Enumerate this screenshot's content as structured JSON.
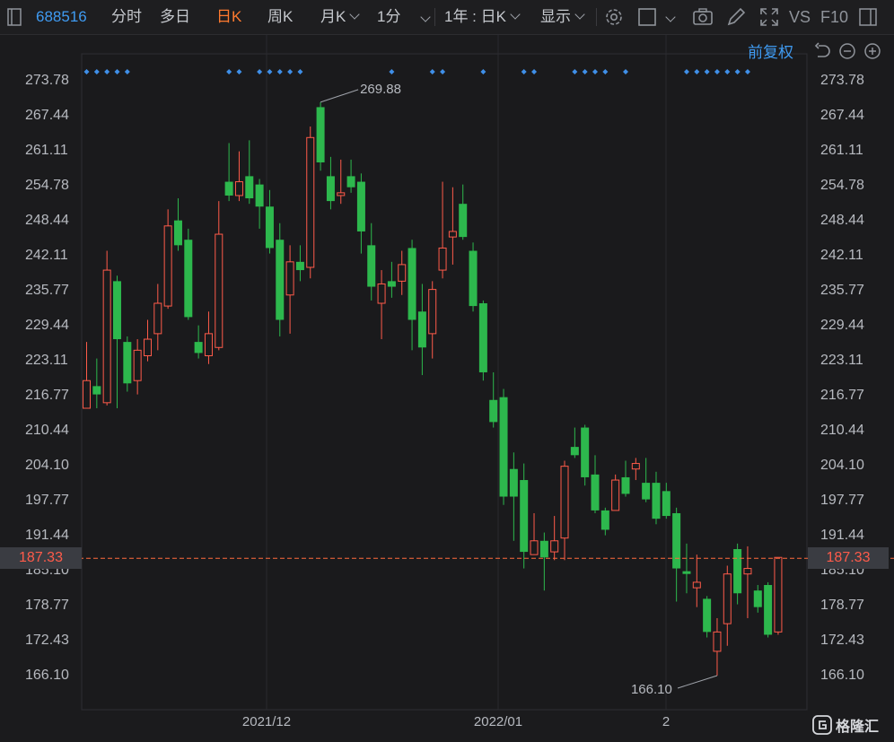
{
  "toolbar": {
    "stock_code": "688516",
    "tabs": [
      "分时",
      "多日",
      "日K",
      "周K",
      "月K",
      "1分"
    ],
    "active_tab": "日K",
    "range_label": "1年 : 日K",
    "display_label": "显示",
    "vs_label": "VS",
    "f10_label": "F10"
  },
  "chart_controls": {
    "adjust_label": "前复权"
  },
  "chart_data": {
    "type": "candlestick",
    "y_ticks": [
      "273.78",
      "267.44",
      "261.11",
      "254.78",
      "248.44",
      "242.11",
      "235.77",
      "229.44",
      "223.11",
      "216.77",
      "210.44",
      "204.10",
      "197.77",
      "191.44",
      "185.10",
      "178.77",
      "172.43",
      "166.10"
    ],
    "ylim": [
      166.1,
      273.78
    ],
    "x_labels": [
      "2021/12",
      "2022/01",
      "2"
    ],
    "last_price": "187.33",
    "high_label": "269.88",
    "low_label": "166.10",
    "up_color": "#ff5b4a",
    "down_color": "#2db84d",
    "candles": [
      {
        "o": 214.5,
        "c": 219.5,
        "h": 226.5,
        "l": 214.5
      },
      {
        "o": 218.5,
        "c": 217.0,
        "h": 223.5,
        "l": 214.5
      },
      {
        "o": 215.5,
        "c": 239.5,
        "h": 243.0,
        "l": 215.0
      },
      {
        "o": 237.5,
        "c": 227.0,
        "h": 238.5,
        "l": 214.5
      },
      {
        "o": 226.5,
        "c": 219.0,
        "h": 227.5,
        "l": 217.5
      },
      {
        "o": 219.5,
        "c": 225.0,
        "h": 227.0,
        "l": 217.0
      },
      {
        "o": 224.0,
        "c": 227.0,
        "h": 230.5,
        "l": 223.0
      },
      {
        "o": 228.0,
        "c": 233.5,
        "h": 237.0,
        "l": 225.0
      },
      {
        "o": 233.0,
        "c": 247.5,
        "h": 250.5,
        "l": 232.5
      },
      {
        "o": 248.5,
        "c": 244.0,
        "h": 252.5,
        "l": 243.0
      },
      {
        "o": 245.0,
        "c": 231.0,
        "h": 247.0,
        "l": 230.5
      },
      {
        "o": 226.5,
        "c": 224.5,
        "h": 229.5,
        "l": 223.5
      },
      {
        "o": 224.0,
        "c": 228.0,
        "h": 232.0,
        "l": 222.5
      },
      {
        "o": 225.5,
        "c": 246.0,
        "h": 252.0,
        "l": 225.0
      },
      {
        "o": 255.5,
        "c": 253.0,
        "h": 262.5,
        "l": 252.0
      },
      {
        "o": 253.0,
        "c": 255.5,
        "h": 261.0,
        "l": 252.0
      },
      {
        "o": 256.5,
        "c": 252.5,
        "h": 263.0,
        "l": 251.5
      },
      {
        "o": 255.0,
        "c": 251.0,
        "h": 256.0,
        "l": 247.0
      },
      {
        "o": 251.0,
        "c": 243.5,
        "h": 254.0,
        "l": 242.5
      },
      {
        "o": 245.0,
        "c": 230.5,
        "h": 248.0,
        "l": 227.5
      },
      {
        "o": 235.0,
        "c": 241.0,
        "h": 244.0,
        "l": 228.0
      },
      {
        "o": 241.0,
        "c": 239.5,
        "h": 244.0,
        "l": 237.5
      },
      {
        "o": 240.0,
        "c": 263.5,
        "h": 265.5,
        "l": 238.0
      },
      {
        "o": 269.0,
        "c": 259.0,
        "h": 269.9,
        "l": 257.5
      },
      {
        "o": 256.5,
        "c": 252.0,
        "h": 260.0,
        "l": 250.5
      },
      {
        "o": 253.0,
        "c": 253.5,
        "h": 259.5,
        "l": 251.5
      },
      {
        "o": 256.5,
        "c": 254.5,
        "h": 259.5,
        "l": 253.5
      },
      {
        "o": 255.5,
        "c": 246.5,
        "h": 257.0,
        "l": 242.5
      },
      {
        "o": 244.0,
        "c": 236.5,
        "h": 248.0,
        "l": 234.0
      },
      {
        "o": 233.5,
        "c": 237.0,
        "h": 239.5,
        "l": 227.0
      },
      {
        "o": 237.5,
        "c": 236.5,
        "h": 241.0,
        "l": 234.5
      },
      {
        "o": 237.5,
        "c": 240.5,
        "h": 243.0,
        "l": 235.0
      },
      {
        "o": 243.5,
        "c": 230.5,
        "h": 245.0,
        "l": 225.0
      },
      {
        "o": 232.0,
        "c": 225.5,
        "h": 237.0,
        "l": 220.5
      },
      {
        "o": 228.0,
        "c": 236.0,
        "h": 237.5,
        "l": 223.5
      },
      {
        "o": 239.5,
        "c": 243.5,
        "h": 255.5,
        "l": 238.0
      },
      {
        "o": 245.5,
        "c": 246.5,
        "h": 254.5,
        "l": 240.5
      },
      {
        "o": 251.5,
        "c": 245.5,
        "h": 255.0,
        "l": 245.0
      },
      {
        "o": 243.0,
        "c": 233.0,
        "h": 244.5,
        "l": 232.0
      },
      {
        "o": 233.5,
        "c": 221.0,
        "h": 234.0,
        "l": 219.5
      },
      {
        "o": 216.0,
        "c": 212.0,
        "h": 221.0,
        "l": 211.0
      },
      {
        "o": 216.5,
        "c": 198.5,
        "h": 218.0,
        "l": 197.0
      },
      {
        "o": 203.5,
        "c": 198.5,
        "h": 206.5,
        "l": 190.5
      },
      {
        "o": 201.5,
        "c": 188.5,
        "h": 204.5,
        "l": 185.5
      },
      {
        "o": 188.0,
        "c": 190.5,
        "h": 195.5,
        "l": 188.0
      },
      {
        "o": 190.5,
        "c": 187.5,
        "h": 192.0,
        "l": 181.5
      },
      {
        "o": 188.5,
        "c": 190.5,
        "h": 195.0,
        "l": 187.0
      },
      {
        "o": 191.0,
        "c": 204.0,
        "h": 205.0,
        "l": 187.0
      },
      {
        "o": 207.5,
        "c": 206.0,
        "h": 211.0,
        "l": 205.5
      },
      {
        "o": 211.0,
        "c": 202.0,
        "h": 211.5,
        "l": 200.5
      },
      {
        "o": 202.5,
        "c": 196.0,
        "h": 206.0,
        "l": 195.5
      },
      {
        "o": 196.0,
        "c": 192.5,
        "h": 196.5,
        "l": 191.5
      },
      {
        "o": 196.0,
        "c": 201.5,
        "h": 202.5,
        "l": 196.0
      },
      {
        "o": 202.0,
        "c": 199.0,
        "h": 205.0,
        "l": 198.5
      },
      {
        "o": 203.5,
        "c": 204.5,
        "h": 205.5,
        "l": 201.5
      },
      {
        "o": 201.0,
        "c": 198.0,
        "h": 205.5,
        "l": 197.5
      },
      {
        "o": 201.0,
        "c": 194.5,
        "h": 203.0,
        "l": 193.5
      },
      {
        "o": 199.5,
        "c": 195.0,
        "h": 201.0,
        "l": 194.5
      },
      {
        "o": 195.5,
        "c": 185.5,
        "h": 196.5,
        "l": 179.5
      },
      {
        "o": 185.0,
        "c": 184.5,
        "h": 190.0,
        "l": 181.0
      },
      {
        "o": 182.0,
        "c": 183.0,
        "h": 188.0,
        "l": 178.5
      },
      {
        "o": 180.0,
        "c": 174.0,
        "h": 180.5,
        "l": 173.0
      },
      {
        "o": 170.5,
        "c": 174.0,
        "h": 176.5,
        "l": 166.1
      },
      {
        "o": 175.5,
        "c": 184.5,
        "h": 186.0,
        "l": 171.5
      },
      {
        "o": 189.0,
        "c": 181.0,
        "h": 190.0,
        "l": 179.0
      },
      {
        "o": 184.5,
        "c": 185.5,
        "h": 189.5,
        "l": 176.5
      },
      {
        "o": 181.5,
        "c": 178.5,
        "h": 182.5,
        "l": 177.5
      },
      {
        "o": 182.5,
        "c": 173.5,
        "h": 183.0,
        "l": 173.0
      },
      {
        "o": 174.0,
        "c": 187.5,
        "h": 187.5,
        "l": 173.5
      }
    ],
    "signal_markers_at": [
      0,
      1,
      2,
      3,
      4,
      14,
      15,
      17,
      18,
      19,
      20,
      21,
      30,
      34,
      35,
      39,
      43,
      44,
      48,
      49,
      50,
      51,
      53,
      59,
      60,
      61,
      62,
      63,
      64,
      65
    ]
  }
}
